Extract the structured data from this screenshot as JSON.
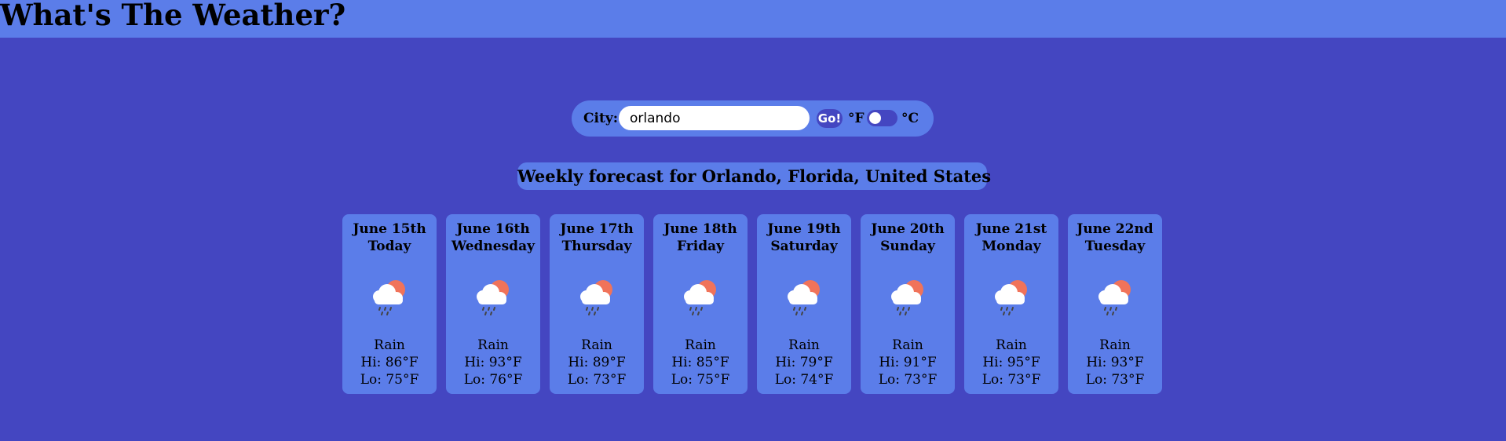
{
  "header": {
    "title": "What's The Weather?"
  },
  "search": {
    "city_label": "City:",
    "city_value": "orlando",
    "go_label": "Go!",
    "unit_f_label": "°F",
    "unit_c_label": "°C",
    "unit_toggle_celsius": false
  },
  "forecast": {
    "title": "Weekly forecast for Orlando, Florida, United States",
    "days": [
      {
        "date": "June 15th",
        "day": "Today",
        "condition": "Rain",
        "hi": "Hi: 86°F",
        "lo": "Lo: 75°F",
        "icon": "rain-cloud-sun-icon"
      },
      {
        "date": "June 16th",
        "day": "Wednesday",
        "condition": "Rain",
        "hi": "Hi: 93°F",
        "lo": "Lo: 76°F",
        "icon": "rain-cloud-sun-icon"
      },
      {
        "date": "June 17th",
        "day": "Thursday",
        "condition": "Rain",
        "hi": "Hi: 89°F",
        "lo": "Lo: 73°F",
        "icon": "rain-cloud-sun-icon"
      },
      {
        "date": "June 18th",
        "day": "Friday",
        "condition": "Rain",
        "hi": "Hi: 85°F",
        "lo": "Lo: 75°F",
        "icon": "rain-cloud-sun-icon"
      },
      {
        "date": "June 19th",
        "day": "Saturday",
        "condition": "Rain",
        "hi": "Hi: 79°F",
        "lo": "Lo: 74°F",
        "icon": "rain-cloud-sun-icon"
      },
      {
        "date": "June 20th",
        "day": "Sunday",
        "condition": "Rain",
        "hi": "Hi: 91°F",
        "lo": "Lo: 73°F",
        "icon": "rain-cloud-sun-icon"
      },
      {
        "date": "June 21st",
        "day": "Monday",
        "condition": "Rain",
        "hi": "Hi: 95°F",
        "lo": "Lo: 73°F",
        "icon": "rain-cloud-sun-icon"
      },
      {
        "date": "June 22nd",
        "day": "Tuesday",
        "condition": "Rain",
        "hi": "Hi: 93°F",
        "lo": "Lo: 73°F",
        "icon": "rain-cloud-sun-icon"
      }
    ]
  },
  "colors": {
    "background": "#4446c1",
    "panel": "#5b7de9",
    "sun": "#f0735a",
    "cloud": "#ffffff"
  }
}
